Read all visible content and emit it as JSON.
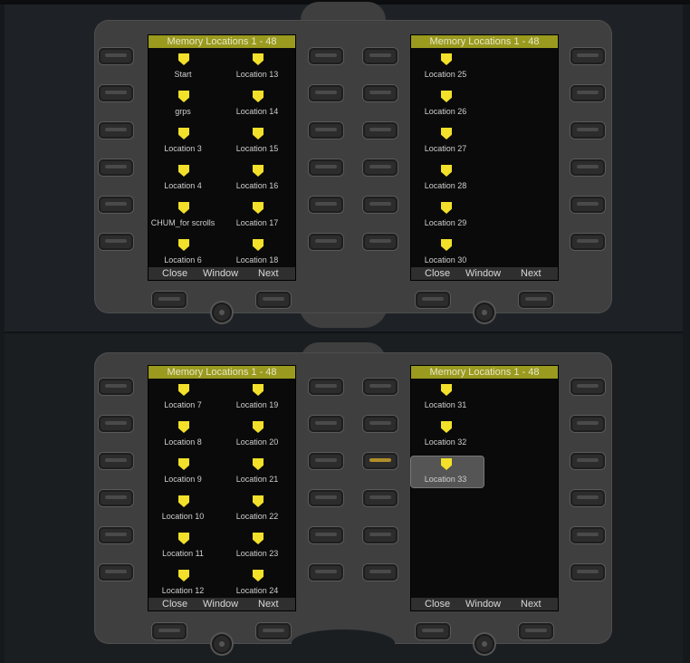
{
  "colors": {
    "title_bar": "#9a9a1f",
    "marker": "#f2e02a",
    "panel": "#3f3f3f",
    "screen": "#0a0a0a"
  },
  "icons": {
    "location_marker": "memory-location-marker-icon",
    "knob": "knob-icon"
  },
  "top": {
    "left": {
      "title": "Memory Locations 1 - 48",
      "locations": [
        "Start",
        "grps",
        "Location 3",
        "Location 4",
        "CHUM_for scrolls",
        "Location 6",
        "Location 13",
        "Location 14",
        "Location 15",
        "Location 16",
        "Location 17",
        "Location 18"
      ],
      "footer": {
        "close": "Close",
        "window": "Window",
        "next": "Next"
      }
    },
    "right": {
      "title": "Memory Locations 1 - 48",
      "locations": [
        "Location 25",
        "Location 26",
        "Location 27",
        "Location 28",
        "Location 29",
        "Location 30"
      ],
      "footer": {
        "close": "Close",
        "window": "Window",
        "next": "Next"
      }
    }
  },
  "bottom": {
    "left": {
      "title": "Memory Locations 1 - 48",
      "locations": [
        "Location 7",
        "Location 8",
        "Location 9",
        "Location 10",
        "Location 11",
        "Location 12",
        "Location 19",
        "Location 20",
        "Location 21",
        "Location 22",
        "Location 23",
        "Location 24"
      ],
      "footer": {
        "close": "Close",
        "window": "Window",
        "next": "Next"
      }
    },
    "right": {
      "title": "Memory Locations 1 - 48",
      "locations": [
        "Location 31",
        "Location 32",
        "Location 33"
      ],
      "selected_location": "Location 33",
      "footer": {
        "close": "Close",
        "window": "Window",
        "next": "Next"
      }
    }
  }
}
